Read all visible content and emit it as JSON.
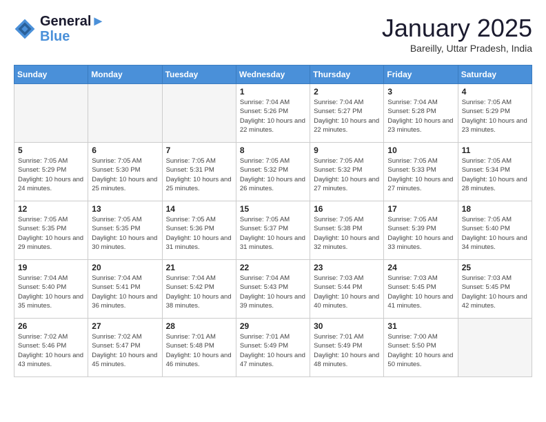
{
  "logo": {
    "line1": "General",
    "line2": "Blue"
  },
  "title": "January 2025",
  "subtitle": "Bareilly, Uttar Pradesh, India",
  "weekdays": [
    "Sunday",
    "Monday",
    "Tuesday",
    "Wednesday",
    "Thursday",
    "Friday",
    "Saturday"
  ],
  "weeks": [
    [
      {
        "day": "",
        "empty": true
      },
      {
        "day": "",
        "empty": true
      },
      {
        "day": "",
        "empty": true
      },
      {
        "day": "1",
        "sunrise": "7:04 AM",
        "sunset": "5:26 PM",
        "daylight": "10 hours and 22 minutes."
      },
      {
        "day": "2",
        "sunrise": "7:04 AM",
        "sunset": "5:27 PM",
        "daylight": "10 hours and 22 minutes."
      },
      {
        "day": "3",
        "sunrise": "7:04 AM",
        "sunset": "5:28 PM",
        "daylight": "10 hours and 23 minutes."
      },
      {
        "day": "4",
        "sunrise": "7:05 AM",
        "sunset": "5:29 PM",
        "daylight": "10 hours and 23 minutes."
      }
    ],
    [
      {
        "day": "5",
        "sunrise": "7:05 AM",
        "sunset": "5:29 PM",
        "daylight": "10 hours and 24 minutes."
      },
      {
        "day": "6",
        "sunrise": "7:05 AM",
        "sunset": "5:30 PM",
        "daylight": "10 hours and 25 minutes."
      },
      {
        "day": "7",
        "sunrise": "7:05 AM",
        "sunset": "5:31 PM",
        "daylight": "10 hours and 25 minutes."
      },
      {
        "day": "8",
        "sunrise": "7:05 AM",
        "sunset": "5:32 PM",
        "daylight": "10 hours and 26 minutes."
      },
      {
        "day": "9",
        "sunrise": "7:05 AM",
        "sunset": "5:32 PM",
        "daylight": "10 hours and 27 minutes."
      },
      {
        "day": "10",
        "sunrise": "7:05 AM",
        "sunset": "5:33 PM",
        "daylight": "10 hours and 27 minutes."
      },
      {
        "day": "11",
        "sunrise": "7:05 AM",
        "sunset": "5:34 PM",
        "daylight": "10 hours and 28 minutes."
      }
    ],
    [
      {
        "day": "12",
        "sunrise": "7:05 AM",
        "sunset": "5:35 PM",
        "daylight": "10 hours and 29 minutes."
      },
      {
        "day": "13",
        "sunrise": "7:05 AM",
        "sunset": "5:35 PM",
        "daylight": "10 hours and 30 minutes."
      },
      {
        "day": "14",
        "sunrise": "7:05 AM",
        "sunset": "5:36 PM",
        "daylight": "10 hours and 31 minutes."
      },
      {
        "day": "15",
        "sunrise": "7:05 AM",
        "sunset": "5:37 PM",
        "daylight": "10 hours and 31 minutes."
      },
      {
        "day": "16",
        "sunrise": "7:05 AM",
        "sunset": "5:38 PM",
        "daylight": "10 hours and 32 minutes."
      },
      {
        "day": "17",
        "sunrise": "7:05 AM",
        "sunset": "5:39 PM",
        "daylight": "10 hours and 33 minutes."
      },
      {
        "day": "18",
        "sunrise": "7:05 AM",
        "sunset": "5:40 PM",
        "daylight": "10 hours and 34 minutes."
      }
    ],
    [
      {
        "day": "19",
        "sunrise": "7:04 AM",
        "sunset": "5:40 PM",
        "daylight": "10 hours and 35 minutes."
      },
      {
        "day": "20",
        "sunrise": "7:04 AM",
        "sunset": "5:41 PM",
        "daylight": "10 hours and 36 minutes."
      },
      {
        "day": "21",
        "sunrise": "7:04 AM",
        "sunset": "5:42 PM",
        "daylight": "10 hours and 38 minutes."
      },
      {
        "day": "22",
        "sunrise": "7:04 AM",
        "sunset": "5:43 PM",
        "daylight": "10 hours and 39 minutes."
      },
      {
        "day": "23",
        "sunrise": "7:03 AM",
        "sunset": "5:44 PM",
        "daylight": "10 hours and 40 minutes."
      },
      {
        "day": "24",
        "sunrise": "7:03 AM",
        "sunset": "5:45 PM",
        "daylight": "10 hours and 41 minutes."
      },
      {
        "day": "25",
        "sunrise": "7:03 AM",
        "sunset": "5:45 PM",
        "daylight": "10 hours and 42 minutes."
      }
    ],
    [
      {
        "day": "26",
        "sunrise": "7:02 AM",
        "sunset": "5:46 PM",
        "daylight": "10 hours and 43 minutes."
      },
      {
        "day": "27",
        "sunrise": "7:02 AM",
        "sunset": "5:47 PM",
        "daylight": "10 hours and 45 minutes."
      },
      {
        "day": "28",
        "sunrise": "7:01 AM",
        "sunset": "5:48 PM",
        "daylight": "10 hours and 46 minutes."
      },
      {
        "day": "29",
        "sunrise": "7:01 AM",
        "sunset": "5:49 PM",
        "daylight": "10 hours and 47 minutes."
      },
      {
        "day": "30",
        "sunrise": "7:01 AM",
        "sunset": "5:49 PM",
        "daylight": "10 hours and 48 minutes."
      },
      {
        "day": "31",
        "sunrise": "7:00 AM",
        "sunset": "5:50 PM",
        "daylight": "10 hours and 50 minutes."
      },
      {
        "day": "",
        "empty": true
      }
    ]
  ],
  "labels": {
    "sunrise": "Sunrise:",
    "sunset": "Sunset:",
    "daylight": "Daylight:"
  }
}
